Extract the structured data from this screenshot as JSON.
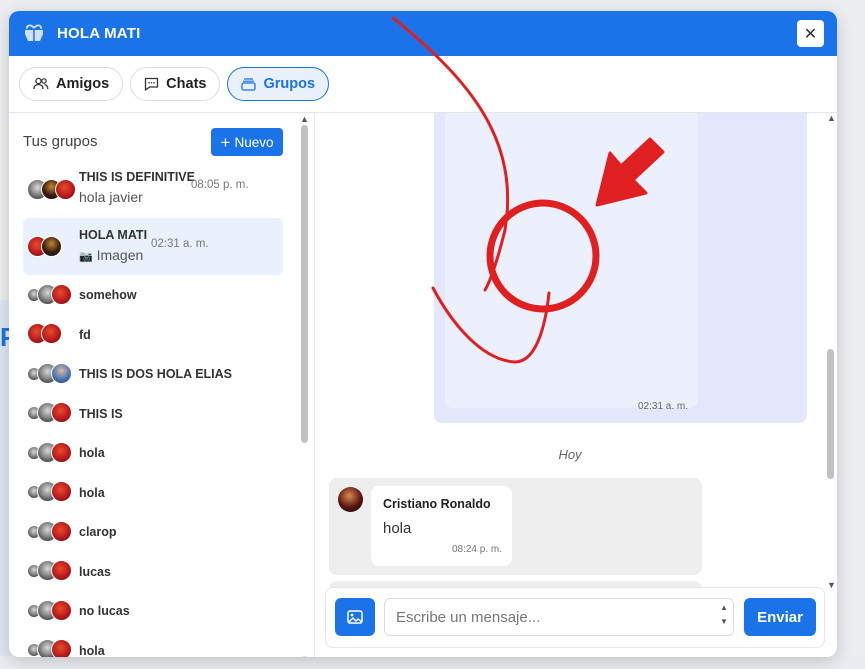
{
  "header": {
    "title": "HOLA MATI",
    "logo_icon": "gift-chat-icon",
    "close_icon": "close-icon"
  },
  "tabs": [
    {
      "label": "Amigos",
      "icon": "users-icon",
      "active": false
    },
    {
      "label": "Chats",
      "icon": "chat-bubble-icon",
      "active": false
    },
    {
      "label": "Grupos",
      "icon": "folder-icon",
      "active": true
    }
  ],
  "sidebar": {
    "title": "Tus grupos",
    "new_button": {
      "label": "Nuevo",
      "icon": "plus-icon"
    },
    "groups": [
      {
        "name": "THIS IS DEFINITIVE",
        "time": "08:05 p. m.",
        "last_message": "hola javier",
        "selected": false
      },
      {
        "name": "HOLA MATI",
        "time": "02:31 a. m.",
        "last_message": "Imagen",
        "last_message_icon": "camera-icon",
        "selected": true
      },
      {
        "name": "somehow"
      },
      {
        "name": "fd"
      },
      {
        "name": "THIS IS DOS HOLA ELIAS"
      },
      {
        "name": "THIS IS"
      },
      {
        "name": "hola"
      },
      {
        "name": "hola"
      },
      {
        "name": "clarop"
      },
      {
        "name": "lucas"
      },
      {
        "name": "no lucas"
      },
      {
        "name": "hola"
      }
    ]
  },
  "chat": {
    "image_message_time": "02:31 a. m.",
    "day_separator": "Hoy",
    "messages": [
      {
        "author": "Cristiano Ronaldo",
        "text": "hola",
        "time": "08:24 p. m."
      }
    ]
  },
  "composer": {
    "placeholder": "Escribe un mensaje...",
    "send_label": "Enviar",
    "image_button_icon": "image-icon"
  },
  "colors": {
    "primary": "#1a73e8",
    "annotation": "#e02020",
    "selected_bg": "#e9f1fd"
  }
}
